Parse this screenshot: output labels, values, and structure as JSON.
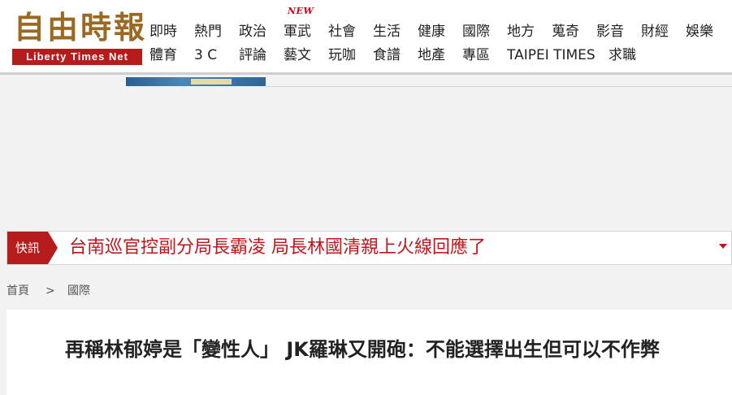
{
  "logo": {
    "name_cn": "自由時報",
    "name_en": "Liberty Times Net"
  },
  "nav": {
    "new_badge": "NEW",
    "row1": [
      "即時",
      "熱門",
      "政治",
      "軍武",
      "社會",
      "生活",
      "健康",
      "國際",
      "地方",
      "蒐奇",
      "影音",
      "財經",
      "娛樂"
    ],
    "row2": [
      "體育",
      "3 C",
      "評論",
      "藝文",
      "玩咖",
      "食譜",
      "地產",
      "專區",
      "TAIPEI TIMES",
      "求職"
    ]
  },
  "breaking": {
    "label": "快訊",
    "headline": "台南巡官控副分局長霸凌 局長林國清親上火線回應了"
  },
  "breadcrumb": {
    "home": "首頁",
    "separator": ">",
    "section": "國際"
  },
  "article": {
    "title": "再稱林郁婷是「變性人」 JK羅琳又開砲：不能選擇出生但可以不作弊"
  },
  "colors": {
    "brand_red": "#b71c1c",
    "headline_red": "#c0161b",
    "logo_gold": "#9a6a25"
  }
}
